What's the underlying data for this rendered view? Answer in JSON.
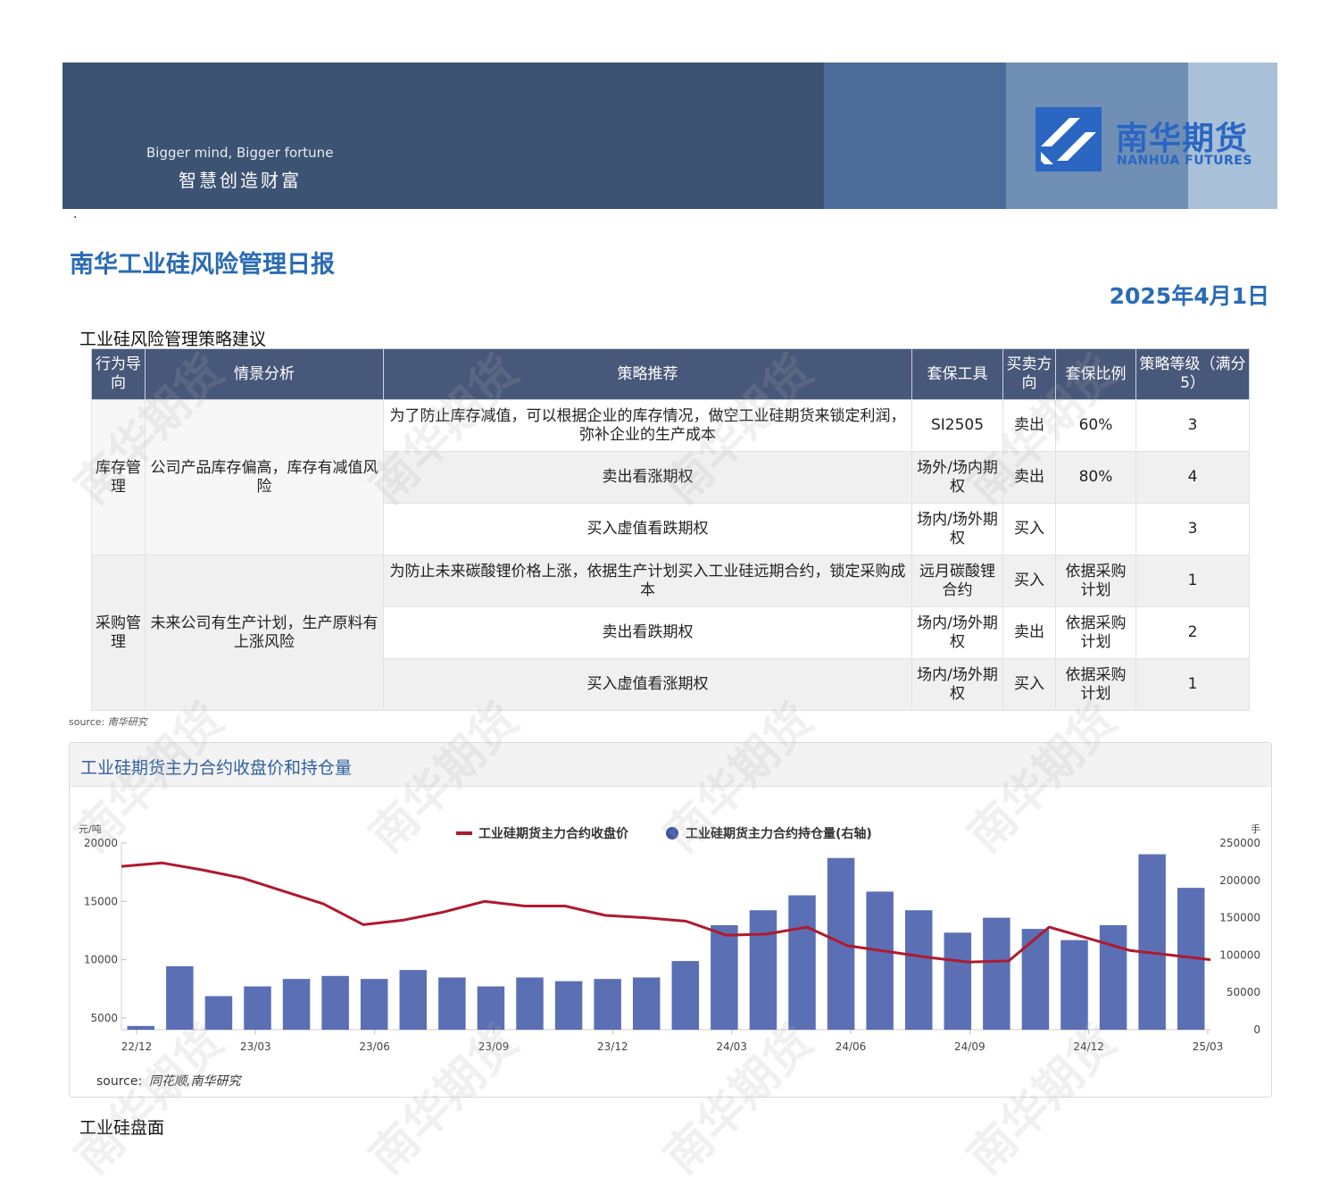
{
  "banner": {
    "slogan_en": "Bigger mind, Bigger fortune",
    "slogan_cn": "智慧创造财富",
    "logo_cn": "南华期货",
    "logo_en": "NANHUA FUTURES"
  },
  "dot": "·",
  "report_title": "南华工业硅风险管理日报",
  "report_date": "2025年4月1日",
  "strategy": {
    "heading": "工业硅风险管理策略建议",
    "headers": [
      "行为导向",
      "情景分析",
      "策略推荐",
      "套保工具",
      "买卖方向",
      "套保比例",
      "策略等级（满分5）"
    ],
    "groups": [
      {
        "direction": "库存管理",
        "scenario": "公司产品库存偏高，库存有减值风险",
        "rows": [
          {
            "strategy": "为了防止库存减值，可以根据企业的库存情况，做空工业硅期货来锁定利润，弥补企业的生产成本",
            "tool": "SI2505",
            "side": "卖出",
            "ratio": "60%",
            "level": "3"
          },
          {
            "strategy": "卖出看涨期权",
            "tool": "场外/场内期权",
            "side": "卖出",
            "ratio": "80%",
            "level": "4"
          },
          {
            "strategy": "买入虚值看跌期权",
            "tool": "场内/场外期权",
            "side": "买入",
            "ratio": "",
            "level": "3"
          }
        ]
      },
      {
        "direction": "采购管理",
        "scenario": "未来公司有生产计划，生产原料有上涨风险",
        "rows": [
          {
            "strategy": "为防止未来碳酸锂价格上涨，依据生产计划买入工业硅远期合约，锁定采购成本",
            "tool": "远月碳酸锂合约",
            "side": "买入",
            "ratio": "依据采购计划",
            "level": "1"
          },
          {
            "strategy": "卖出看跌期权",
            "tool": "场内/场外期权",
            "side": "卖出",
            "ratio": "依据采购计划",
            "level": "2"
          },
          {
            "strategy": "买入虚值看涨期权",
            "tool": "场内/场外期权",
            "side": "买入",
            "ratio": "依据采购计划",
            "level": "1"
          }
        ]
      }
    ],
    "source_label": "source:",
    "source_text": "南华研究"
  },
  "chart_card": {
    "title": "工业硅期货主力合约收盘价和持仓量",
    "source_label": "source:",
    "source_text": "同花顺,南华研究"
  },
  "chart_data": {
    "type": "line",
    "left_unit": "元/吨",
    "right_unit": "手",
    "legend": [
      "工业硅期货主力合约收盘价",
      "工业硅期货主力合约持仓量(右轴)"
    ],
    "legend_position": "top-center",
    "x_ticks": [
      "22/12",
      "23/03",
      "23/06",
      "23/09",
      "23/12",
      "24/03",
      "24/06",
      "24/09",
      "24/12",
      "25/03"
    ],
    "y_left_ticks": [
      20000,
      15000,
      10000,
      5000
    ],
    "y_left_range": [
      4000,
      20000
    ],
    "y_right_ticks": [
      250000,
      200000,
      150000,
      100000,
      50000,
      0
    ],
    "y_right_range": [
      0,
      250000
    ],
    "series": [
      {
        "name": "工业硅期货主力合约收盘价",
        "color": "#b0192e",
        "x": [
          "22/12",
          "23/01",
          "23/02",
          "23/03",
          "23/04",
          "23/05",
          "23/06",
          "23/07",
          "23/08",
          "23/09",
          "23/10",
          "23/11",
          "23/12",
          "24/01",
          "24/02",
          "24/03",
          "24/04",
          "24/05",
          "24/06",
          "24/07",
          "24/08",
          "24/09",
          "24/10",
          "24/11",
          "24/12",
          "25/01",
          "25/02",
          "25/03"
        ],
        "values": [
          18000,
          18300,
          17700,
          17000,
          15900,
          14800,
          13000,
          13400,
          14100,
          15000,
          14600,
          14600,
          13800,
          13600,
          13300,
          12100,
          12200,
          12800,
          11200,
          10700,
          10200,
          9800,
          9900,
          12800,
          11800,
          10800,
          10400,
          10000
        ]
      },
      {
        "name": "工业硅期货主力合约持仓量(右轴)",
        "color": "#3e56a8",
        "x": [
          "22/12",
          "23/01",
          "23/02",
          "23/03",
          "23/04",
          "23/05",
          "23/06",
          "23/07",
          "23/08",
          "23/09",
          "23/10",
          "23/11",
          "23/12",
          "24/01",
          "24/02",
          "24/03",
          "24/04",
          "24/05",
          "24/06",
          "24/07",
          "24/08",
          "24/09",
          "24/10",
          "24/11",
          "24/12",
          "25/01",
          "25/02",
          "25/03"
        ],
        "values": [
          5000,
          85000,
          45000,
          58000,
          68000,
          72000,
          68000,
          80000,
          70000,
          58000,
          70000,
          65000,
          68000,
          70000,
          92000,
          140000,
          160000,
          180000,
          230000,
          185000,
          160000,
          130000,
          150000,
          135000,
          120000,
          140000,
          235000,
          190000
        ]
      }
    ]
  },
  "section2": "工业硅盘面",
  "watermark": "南华期货"
}
